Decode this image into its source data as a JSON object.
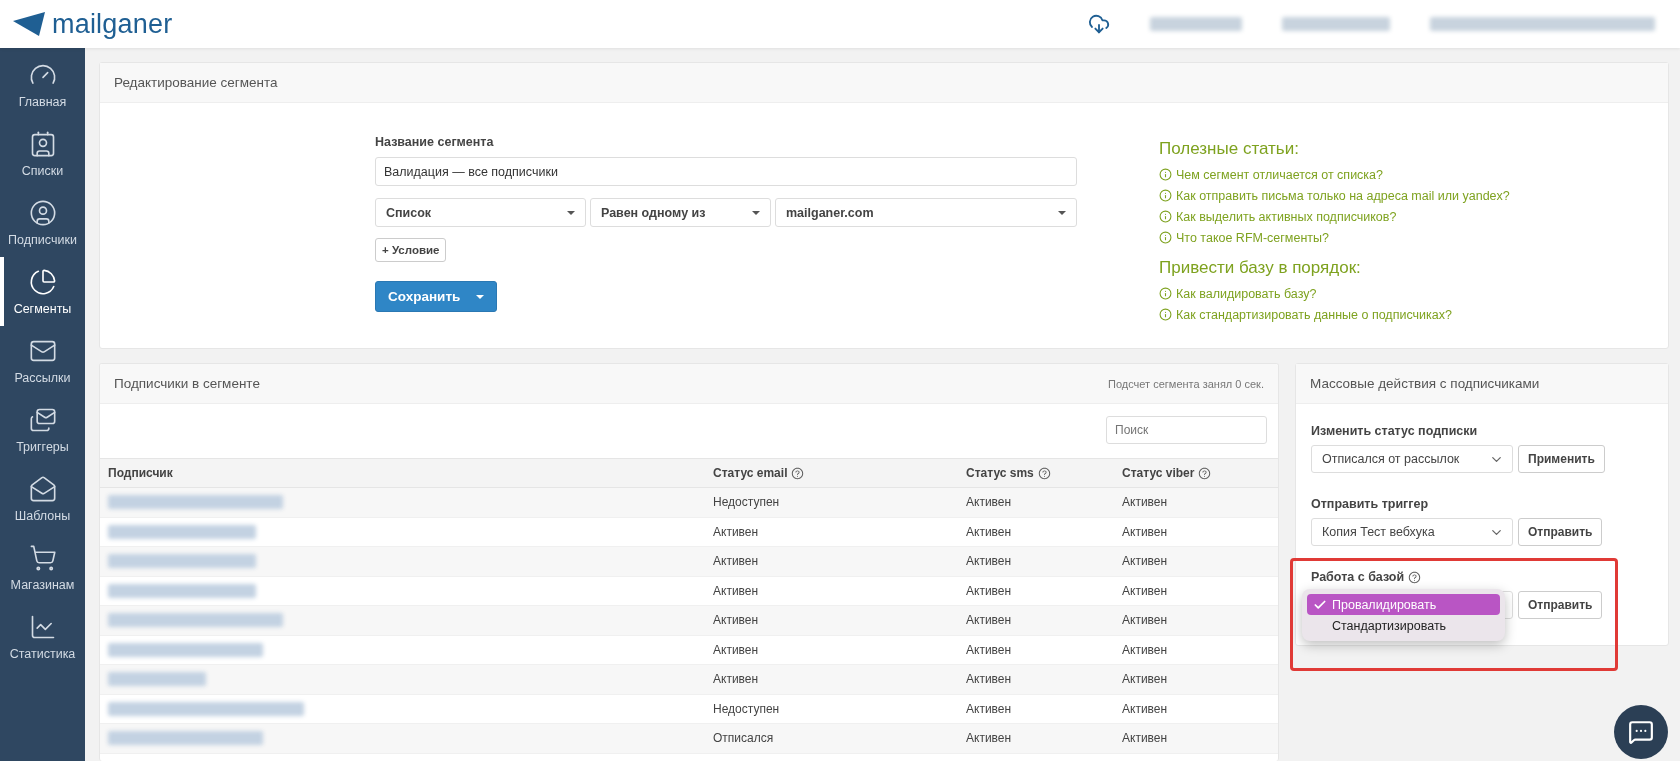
{
  "header": {
    "logo": "mailganer"
  },
  "sidebar": {
    "items": [
      {
        "label": "Главная",
        "selected": false
      },
      {
        "label": "Списки",
        "selected": false
      },
      {
        "label": "Подписчики",
        "selected": false
      },
      {
        "label": "Сегменты",
        "selected": true
      },
      {
        "label": "Рассылки",
        "selected": false
      },
      {
        "label": "Триггеры",
        "selected": false
      },
      {
        "label": "Шаблоны",
        "selected": false
      },
      {
        "label": "Магазинам",
        "selected": false
      },
      {
        "label": "Статистика",
        "selected": false
      }
    ]
  },
  "segment_editor": {
    "title": "Редактирование сегмента",
    "name_label": "Название сегмента",
    "name_value": "Валидация — все подписчики",
    "condition": [
      "Список",
      "Равен одному из",
      "mailganer.com"
    ],
    "add_condition": "+ Условие",
    "save_button": "Сохранить"
  },
  "articles": [
    {
      "heading": "Полезные статьи:",
      "links": [
        "Чем сегмент отличается от списка?",
        "Как отправить письма только на адреса mail или yandex?",
        "Как выделить активных подписчиков?",
        "Что такое RFM-сегменты?"
      ]
    },
    {
      "heading": "Привести базу в порядок:",
      "links": [
        "Как валидировать базу?",
        "Как стандартизировать данные о подписчиках?"
      ]
    }
  ],
  "subscribers": {
    "title": "Подписчики в сегменте",
    "timing": "Подсчет сегмента занял 0 сек.",
    "search": {
      "placeholder": "Поиск"
    },
    "columns": [
      {
        "label": "Подписчик",
        "help": false
      },
      {
        "label": "Статус email",
        "help": true
      },
      {
        "label": "Статус sms",
        "help": true
      },
      {
        "label": "Статус viber",
        "help": true
      }
    ],
    "rows": [
      {
        "email": "Недоступен",
        "sms": "Активен",
        "viber": "Активен"
      },
      {
        "email": "Активен",
        "sms": "Активен",
        "viber": "Активен"
      },
      {
        "email": "Активен",
        "sms": "Активен",
        "viber": "Активен"
      },
      {
        "email": "Активен",
        "sms": "Активен",
        "viber": "Активен"
      },
      {
        "email": "Активен",
        "sms": "Активен",
        "viber": "Активен"
      },
      {
        "email": "Активен",
        "sms": "Активен",
        "viber": "Активен"
      },
      {
        "email": "Активен",
        "sms": "Активен",
        "viber": "Активен"
      },
      {
        "email": "Недоступен",
        "sms": "Активен",
        "viber": "Активен"
      },
      {
        "email": "Отписался",
        "sms": "Активен",
        "viber": "Активен"
      }
    ]
  },
  "mass_actions": {
    "title": "Массовые действия с подписчиками",
    "groups": [
      {
        "label": "Изменить статус подписки",
        "help": false,
        "value": "Отписался от рассылок",
        "button": "Применить"
      },
      {
        "label": "Отправить триггер",
        "help": false,
        "value": "Копия Тест вебхука",
        "button": "Отправить"
      },
      {
        "label": "Работа с базой",
        "help": true,
        "button": "Отправить",
        "highlighted": true,
        "menu": [
          {
            "label": "Провалидировать",
            "selected": true
          },
          {
            "label": "Стандартизировать",
            "selected": false
          }
        ]
      }
    ]
  }
}
